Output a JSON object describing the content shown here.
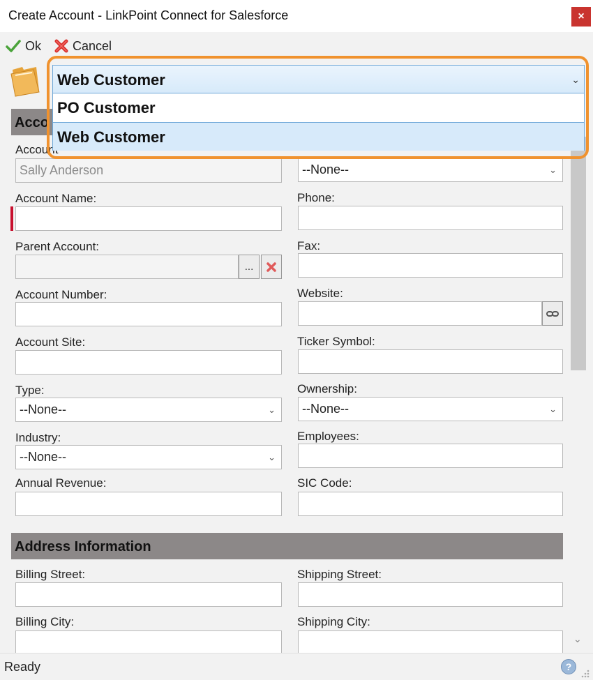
{
  "window": {
    "title": "Create Account - LinkPoint Connect for Salesforce",
    "close_label": "×"
  },
  "toolbar": {
    "ok_label": "Ok",
    "cancel_label": "Cancel"
  },
  "record_type": {
    "selected": "Web Customer",
    "options": [
      "PO Customer",
      "Web Customer"
    ]
  },
  "account_section": {
    "header_visible": "Acco",
    "owner_label_visible": "Account",
    "owner_value": "Sally Anderson",
    "rating_value": "--None--",
    "fields": {
      "account_name": "Account Name:",
      "phone": "Phone:",
      "parent_account": "Parent Account:",
      "fax": "Fax:",
      "account_number": "Account Number:",
      "website": "Website:",
      "account_site": "Account Site:",
      "ticker_symbol": "Ticker Symbol:",
      "type": "Type:",
      "ownership": "Ownership:",
      "industry": "Industry:",
      "employees": "Employees:",
      "annual_revenue": "Annual Revenue:",
      "sic_code": "SIC Code:"
    },
    "type_value": "--None--",
    "ownership_value": "--None--",
    "industry_value": "--None--",
    "browse_label": "..."
  },
  "address_section": {
    "header": "Address Information",
    "billing_street": "Billing Street:",
    "shipping_street": "Shipping Street:",
    "billing_city": "Billing City:",
    "shipping_city": "Shipping City:"
  },
  "status": {
    "text": "Ready"
  },
  "colors": {
    "highlight": "#f0922e",
    "section_header": "#8c8888",
    "required": "#c8102e"
  }
}
